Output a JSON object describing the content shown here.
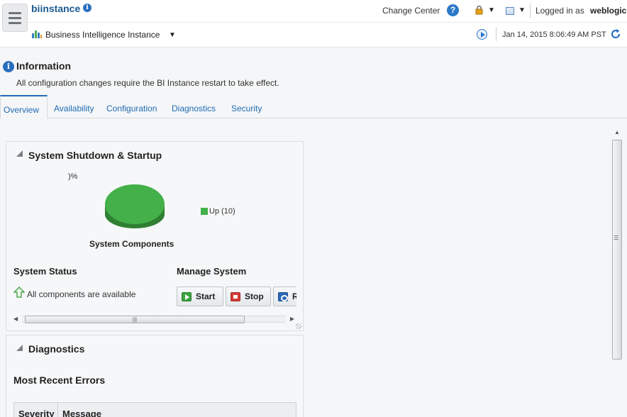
{
  "header": {
    "title": "biinstance",
    "change_center": "Change Center",
    "logged_in_label": "Logged in as",
    "user": "weblogic",
    "target_name": "Business Intelligence Instance",
    "timestamp": "Jan 14, 2015 8:06:49 AM PST"
  },
  "info": {
    "title": "Information",
    "message": "All configuration changes require the BI Instance restart to take effect."
  },
  "tabs": [
    {
      "label": "Overview",
      "active": true
    },
    {
      "label": "Availability",
      "active": false
    },
    {
      "label": "Configuration",
      "active": false
    },
    {
      "label": "Diagnostics",
      "active": false
    },
    {
      "label": "Security",
      "active": false
    }
  ],
  "shutdown_panel": {
    "title": "System Shutdown & Startup",
    "pie_percent_label": ")%",
    "legend_label": "Up (10)",
    "legend_color": "#44b04a",
    "components_label": "System Components",
    "status_title": "System Status",
    "status_message": "All components are available",
    "manage_title": "Manage System",
    "buttons": {
      "start": "Start",
      "stop": "Stop",
      "restart": "R"
    }
  },
  "diagnostics_panel": {
    "title": "Diagnostics",
    "errors_title": "Most Recent Errors",
    "columns": [
      "Severity",
      "Message"
    ]
  },
  "chart_data": {
    "type": "pie",
    "title": "System Components",
    "categories": [
      "Up (10)"
    ],
    "values": [
      10
    ],
    "colors": [
      "#44b04a"
    ],
    "legend": "right"
  }
}
